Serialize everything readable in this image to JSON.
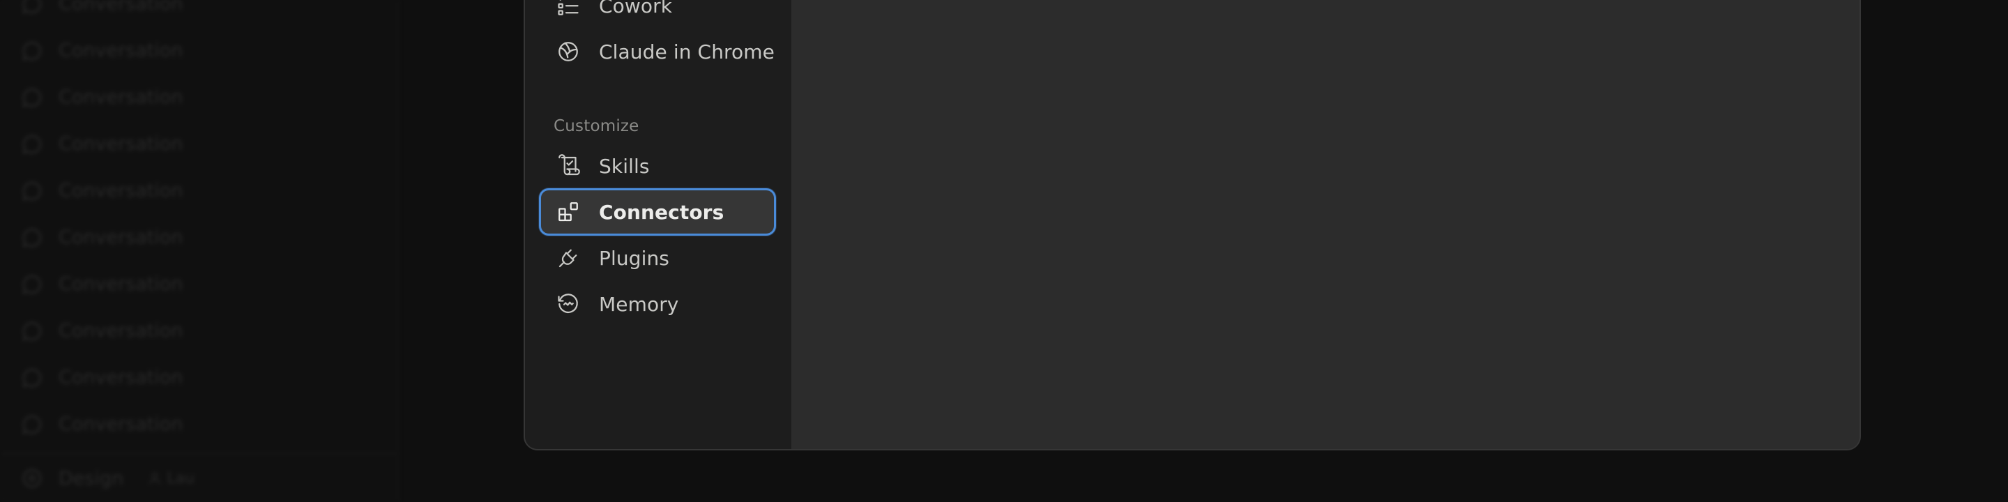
{
  "background_sidebar": {
    "conversations": [
      "Conversation",
      "Conversation",
      "Conversation",
      "Conversation",
      "Conversation",
      "Conversation",
      "Conversation",
      "Conversation",
      "Conversation",
      "Conversation"
    ],
    "footer_label": "Design",
    "footer_badge": "Lau"
  },
  "settings_nav": {
    "top_items": [
      {
        "label": "Cowork",
        "icon": "checklist-icon"
      },
      {
        "label": "Claude in Chrome",
        "icon": "globe-icon"
      }
    ],
    "customize_label": "Customize",
    "customize_items": [
      {
        "label": "Skills",
        "icon": "scroll-icon"
      },
      {
        "label": "Connectors",
        "icon": "connectors-icon",
        "active": true
      },
      {
        "label": "Plugins",
        "icon": "plug-icon"
      },
      {
        "label": "Memory",
        "icon": "memory-icon"
      }
    ]
  },
  "colors": {
    "page_bg": "#0f0f0f",
    "modal_bg": "#2c2c2c",
    "modal_sidebar_bg": "#1d1d1d",
    "active_border": "#4a8bd9",
    "text": "#c9c9c6",
    "muted_text": "#8b8b88"
  }
}
